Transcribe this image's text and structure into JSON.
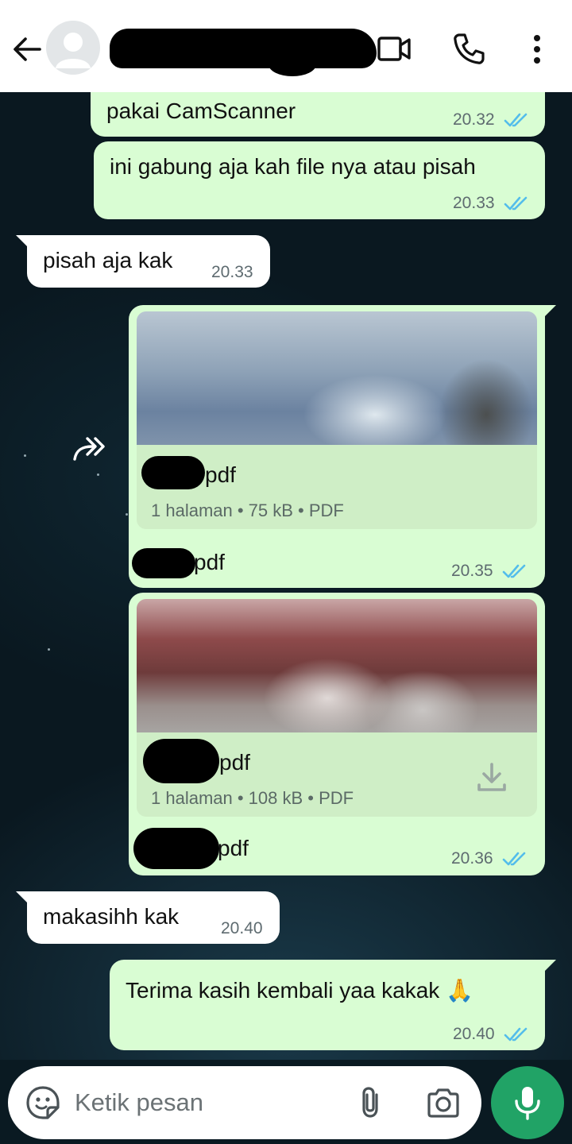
{
  "header": {
    "contact_name": "",
    "icons": [
      "back-arrow-icon",
      "avatar-placeholder-icon",
      "video-call-icon",
      "phone-icon",
      "more-vert-icon"
    ]
  },
  "messages": [
    {
      "dir": "out",
      "text": "pakai CamScanner",
      "time": "20.32",
      "status": "read"
    },
    {
      "dir": "out",
      "text": "ini gabung aja kah file nya atau pisah",
      "time": "20.33",
      "status": "read"
    },
    {
      "dir": "in",
      "text": "pisah aja kak",
      "time": "20.33"
    },
    {
      "dir": "out",
      "type": "document",
      "file_name_suffix": "pdf",
      "meta": "1 halaman • 75 kB • PDF",
      "caption_suffix": "pdf",
      "time": "20.35",
      "status": "read"
    },
    {
      "dir": "out",
      "type": "document",
      "file_name_suffix": "pdf",
      "meta": "1 halaman • 108 kB • PDF",
      "caption_suffix": "pdf",
      "time": "20.36",
      "status": "read"
    },
    {
      "dir": "in",
      "text": "makasihh kak",
      "time": "20.40"
    },
    {
      "dir": "out",
      "text": "Terima kasih kembali yaa kakak 🙏",
      "time": "20.40",
      "status": "read"
    }
  ],
  "input": {
    "placeholder": "Ketik pesan"
  },
  "colors": {
    "outgoing_bubble": "#d9fdd3",
    "incoming_bubble": "#ffffff",
    "read_ticks": "#53bdeb",
    "mic_button": "#21a366",
    "header_bg": "#ffffff"
  }
}
